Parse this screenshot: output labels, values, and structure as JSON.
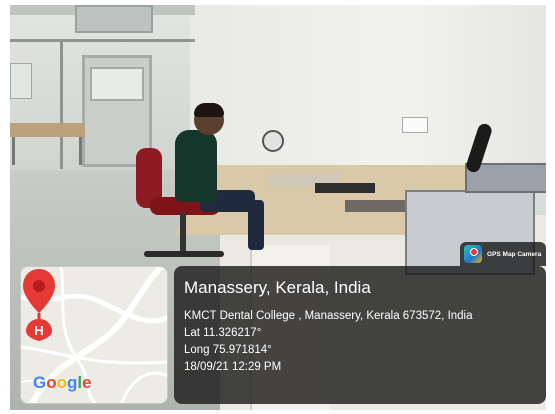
{
  "overlay": {
    "location_title": "Manassery, Kerala, India",
    "address": "KMCT Dental College , Manassery, Kerala 673572, India",
    "latitude": "Lat 11.326217°",
    "longitude": "Long 75.971814°",
    "datetime": "18/09/21 12:29 PM"
  },
  "badge": {
    "app_name": "GPS Map Camera",
    "icon": "gps-map-camera-icon"
  },
  "map": {
    "pin_letter": "H",
    "pin_color": "#e53935",
    "google_letters": [
      "G",
      "o",
      "o",
      "g",
      "l",
      "e"
    ]
  },
  "scene": {
    "icons": [
      "office-chair",
      "person-seated",
      "lab-bench",
      "dental-machine"
    ]
  }
}
